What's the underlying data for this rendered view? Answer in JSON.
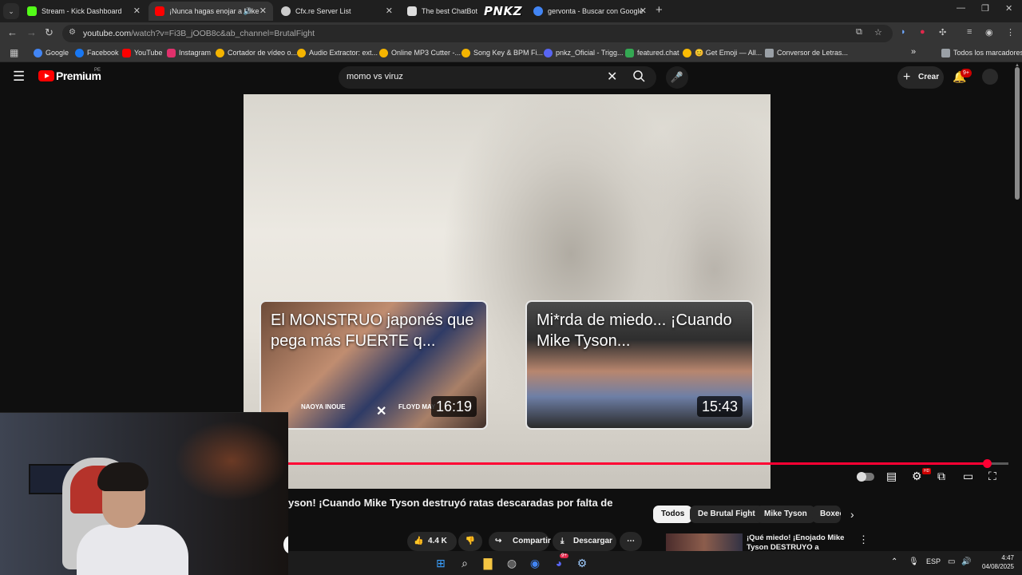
{
  "browser": {
    "tabs": [
      {
        "label": "Stream - Kick Dashboard",
        "icon": "kick-icon",
        "color": "#53fc18"
      },
      {
        "label": "¡Nunca hagas enojar a Mike",
        "icon": "youtube-icon",
        "color": "#ff0000"
      },
      {
        "label": "Cfx.re Server List",
        "icon": "cfx-icon",
        "color": "#cccccc"
      },
      {
        "label": "The best ChatBot and",
        "icon": "chatbot-icon",
        "color": "#dddddd"
      },
      {
        "label": "gervonta - Buscar con Google",
        "icon": "google-icon",
        "color": "#4285f4"
      }
    ],
    "tab_overlay_logo": "PNKZ",
    "url_host": "youtube.com",
    "url_path": "/watch?v=Fi3B_jOOB8c&ab_channel=BrutalFight",
    "bookmarks": [
      {
        "label": "Google",
        "color": "#4285f4"
      },
      {
        "label": "Facebook",
        "color": "#1877f2"
      },
      {
        "label": "YouTube",
        "color": "#ff0000"
      },
      {
        "label": "Instagram",
        "color": "#e1306c"
      },
      {
        "label": "Cortador de vídeo o...",
        "color": "#f4b400"
      },
      {
        "label": "Audio Extractor: ext...",
        "color": "#f4b400"
      },
      {
        "label": "Online MP3 Cutter -...",
        "color": "#f4b400"
      },
      {
        "label": "Song Key & BPM Fi...",
        "color": "#f4b400"
      },
      {
        "label": "pnkz_Oficial - Trigg...",
        "color": "#5865f2"
      },
      {
        "label": "featured.chat",
        "color": "#34a853"
      },
      {
        "label": "😊 Get Emoji — All...",
        "color": "#fbbc04"
      },
      {
        "label": "Conversor de Letras...",
        "color": "#9aa0a6"
      }
    ],
    "all_bookmarks": "Todos los marcadores"
  },
  "youtube": {
    "brand": "Premium",
    "country": "PE",
    "search_query": "momo vs viruz",
    "create_label": "Crear",
    "notifications_badge": "9+",
    "video_title": "yson! ¡Cuando Mike Tyson destruyó ratas descaradas por falta de",
    "endcards": [
      {
        "title": "El MONSTRUO japonés que pega más FUERTE q...",
        "duration": "16:19",
        "left_name": "NAOYA INOUE",
        "right_name": "FLOYD MAY"
      },
      {
        "title": "Mi*rda de miedo... ¡Cuando Mike Tyson...",
        "duration": "15:43"
      }
    ],
    "progress_fraction": 0.97,
    "likes": "4.4 K",
    "share_label": "Compartir",
    "download_label": "Descargar",
    "chips": [
      "Todos",
      "De Brutal Fight",
      "Mike Tyson",
      "Boxeo"
    ],
    "recommended_title": "¡Qué miedo! ¡Enojado Mike Tyson DESTRUYO a peleadore..."
  },
  "taskbar": {
    "language": "ESP",
    "time": "4:47",
    "date": "04/08/2025",
    "discord_badge": "9+"
  }
}
